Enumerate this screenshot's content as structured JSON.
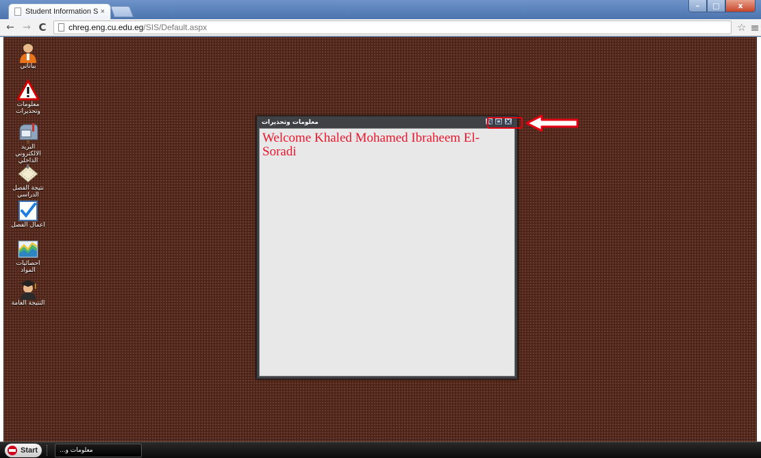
{
  "browser": {
    "tab_title": "Student Information Syste",
    "tab_close": "×",
    "url_host": "chreg.eng.cu.edu.eg",
    "url_path": "/SIS/Default.aspx",
    "window_min": "–",
    "window_max": "□",
    "window_close": "x"
  },
  "desktop_icons": [
    {
      "label": "بياناتي",
      "icon": "student-avatar-icon"
    },
    {
      "label": "معلومات وتحذيرات",
      "icon": "warning-icon"
    },
    {
      "label": "البريد الالكتروني الداخلي",
      "icon": "mailbox-icon"
    },
    {
      "label": "نتيجة الفصل الدراسي",
      "icon": "calendar-icon"
    },
    {
      "label": "اعمال الفصل",
      "icon": "checkmark-doc-icon"
    },
    {
      "label": "احصائيات المواد",
      "icon": "chart-icon"
    },
    {
      "label": "النتيجة العامة",
      "icon": "graduate-icon"
    }
  ],
  "window": {
    "title": "معلومات وتحذيرات",
    "welcome": "Welcome Khaled Mohamed Ibraheem El-Soradi"
  },
  "taskbar": {
    "start_label": "Start",
    "task_label": "معلومات و..."
  },
  "colors": {
    "desktop_bg": "#4a2419",
    "welcome_text": "#e8172d",
    "highlight": "#e60012"
  }
}
